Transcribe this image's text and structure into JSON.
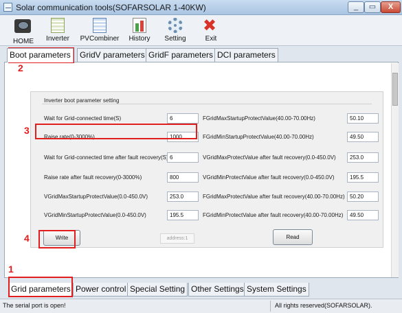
{
  "window": {
    "title": "Solar communication tools(SOFARSOLAR 1-40KW)",
    "minimize": "_",
    "maximize": "▭",
    "close": "X"
  },
  "toolbar": {
    "items": [
      {
        "label": "HOME",
        "icon": "home-icon"
      },
      {
        "label": "Inverter",
        "icon": "inverter-icon"
      },
      {
        "label": "PVCombiner",
        "icon": "pvcombiner-icon"
      },
      {
        "label": "History",
        "icon": "history-icon"
      },
      {
        "label": "Setting",
        "icon": "gear-icon"
      },
      {
        "label": "Exit",
        "icon": "close-icon"
      }
    ]
  },
  "top_tabs": [
    {
      "label": "Boot parameters",
      "active": true
    },
    {
      "label": "GridV parameters",
      "active": false
    },
    {
      "label": "GridF parameters",
      "active": false
    },
    {
      "label": "DCI parameters",
      "active": false
    }
  ],
  "group": {
    "title": "Inverter boot parameter setting",
    "left_fields": [
      {
        "label": "Wait for Grid-connected time(S)",
        "value": "6"
      },
      {
        "label": "Raise rate(0-3000%)",
        "value": "1000"
      },
      {
        "label": "Wait for Grid-connected time after fault recovery(S)",
        "value": "6"
      },
      {
        "label": "Raise rate after fault recovery(0-3000%)",
        "value": "800"
      },
      {
        "label": "VGridMaxStartupProtectValue(0.0-450.0V)",
        "value": "253.0"
      },
      {
        "label": "VGridMinStartupProtectValue(0.0-450.0V)",
        "value": "195.5"
      }
    ],
    "right_fields": [
      {
        "label": "FGridMaxStartupProtectValue(40.00-70.00Hz)",
        "value": "50.10"
      },
      {
        "label": "FGridMinStartupProtectValue(40.00-70.00Hz)",
        "value": "49.50"
      },
      {
        "label": "VGridMaxProtectValue after fault recovery(0.0-450.0V)",
        "value": "253.0"
      },
      {
        "label": "VGridMinProtectValue after fault recovery(0.0-450.0V)",
        "value": "195.5"
      },
      {
        "label": "FGridMaxProtectValue after fault recovery(40.00-70.00Hz)",
        "value": "50.20"
      },
      {
        "label": "FGridMinProtectValue after fault recovery(40.00-70.00Hz)",
        "value": "49.50"
      }
    ],
    "write_button": "Write",
    "address": "address:1",
    "read_button": "Read"
  },
  "annotations": [
    "1",
    "2",
    "3",
    "4"
  ],
  "bottom_tabs": [
    {
      "label": "Grid parameters",
      "active": true
    },
    {
      "label": "Power control",
      "active": false
    },
    {
      "label": "Special Setting",
      "active": false
    },
    {
      "label": "Other Settings",
      "active": false
    },
    {
      "label": "System Settings",
      "active": false
    }
  ],
  "status": {
    "left": "The serial port is open!",
    "right": "All rights reserved(SOFARSOLAR)."
  },
  "colors": {
    "annotation": "#e11d1d",
    "title_bar": "#a9c4e2",
    "close_button": "#c94a35"
  }
}
